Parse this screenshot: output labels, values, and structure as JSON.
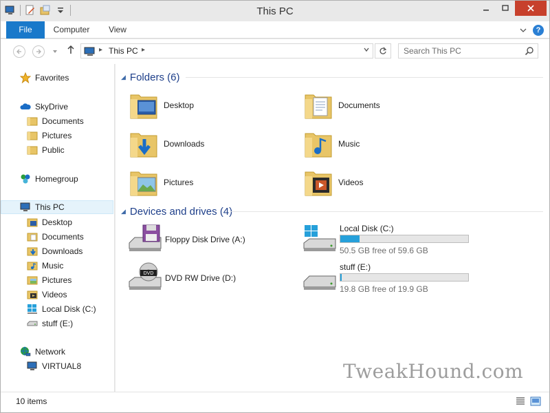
{
  "window": {
    "title": "This PC"
  },
  "ribbon": {
    "tabs": [
      "File",
      "Computer",
      "View"
    ]
  },
  "address": {
    "path": "This PC"
  },
  "search": {
    "placeholder": "Search This PC"
  },
  "nav": {
    "favorites": "Favorites",
    "skydrive": "SkyDrive",
    "skydrive_items": [
      "Documents",
      "Pictures",
      "Public"
    ],
    "homegroup": "Homegroup",
    "thispc": "This PC",
    "thispc_items": [
      "Desktop",
      "Documents",
      "Downloads",
      "Music",
      "Pictures",
      "Videos",
      "Local Disk (C:)",
      "stuff (E:)"
    ],
    "network": "Network",
    "network_items": [
      "VIRTUAL8"
    ]
  },
  "folders": {
    "header": "Folders (6)",
    "items": [
      "Desktop",
      "Documents",
      "Downloads",
      "Music",
      "Pictures",
      "Videos"
    ]
  },
  "devices": {
    "header": "Devices and drives (4)",
    "items": [
      {
        "name": "Floppy Disk Drive (A:)"
      },
      {
        "name": "Local Disk (C:)",
        "free": "50.5 GB free of 59.6 GB",
        "used_fraction": 0.15
      },
      {
        "name": "DVD RW Drive (D:)"
      },
      {
        "name": "stuff (E:)",
        "free": "19.8 GB free of 19.9 GB",
        "used_fraction": 0.01
      }
    ]
  },
  "status": {
    "count": "10 items"
  },
  "watermark": "TweakHound.com",
  "colors": {
    "accent": "#1979ca",
    "close": "#c7402c",
    "drive_fill": "#26a0da",
    "group_header": "#1e3f8a"
  }
}
